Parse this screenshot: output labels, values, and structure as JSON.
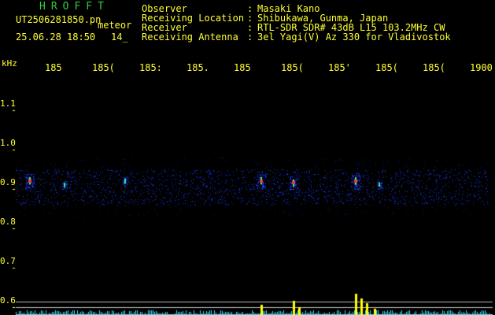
{
  "app": {
    "title": "HROFFT"
  },
  "file": {
    "name": "UT2506281850.pn",
    "tag": "meteor",
    "datetime": "25.06.28 18:50",
    "page": "14_"
  },
  "header": {
    "colon": ":",
    "rows": [
      {
        "label": "Observer",
        "value": "Masaki Kano"
      },
      {
        "label": "Receiving Location",
        "value": "Shibukawa, Gunma, Japan"
      },
      {
        "label": "Receiver",
        "value": "RTL-SDR SDR# 43dB L15 103.2MHz CW"
      },
      {
        "label": "Receiving Antenna",
        "value": "3el Yagi(V) Az 330 for Vladivostok"
      }
    ]
  },
  "axes": {
    "y_unit": "kHz",
    "x_ticks": [
      "185",
      "185(",
      "185:",
      "185.",
      "185",
      "185(",
      "185'",
      "185(",
      "185(",
      "1900"
    ],
    "y_ticks": [
      "1.1",
      "1.0",
      "0.9",
      "0.8",
      "0.7",
      "0.6"
    ]
  },
  "colors": {
    "text": "#ffff33",
    "title": "#33cc44",
    "background": "#000000",
    "noise": "#1a3aff",
    "echo_hot": "#ff3333",
    "echo_warm": "#33ff99",
    "baseline_cyan": "#33e0ff",
    "baseline_peak": "#ffff00",
    "reference_line": "#bbbbbb"
  },
  "chart_data": {
    "type": "heatmap",
    "title": "",
    "xlabel": "",
    "ylabel": "kHz",
    "x_tick_labels": [
      "185",
      "185(",
      "185:",
      "185.",
      "185",
      "185(",
      "185'",
      "185(",
      "185(",
      "1900"
    ],
    "x_range_minutes": [
      1850,
      1900
    ],
    "ylim_khz": [
      0.58,
      1.18
    ],
    "y_ticks": [
      1.1,
      1.0,
      0.9,
      0.8,
      0.7,
      0.6
    ],
    "noise_band_khz": [
      0.86,
      0.95
    ],
    "meteor_echoes": [
      {
        "time": 1851.5,
        "freq_khz": 0.92,
        "strength": 0.9
      },
      {
        "time": 1855.2,
        "freq_khz": 0.91,
        "strength": 0.4
      },
      {
        "time": 1861.6,
        "freq_khz": 0.92,
        "strength": 0.4
      },
      {
        "time": 1876.0,
        "freq_khz": 0.92,
        "strength": 0.9
      },
      {
        "time": 1879.4,
        "freq_khz": 0.915,
        "strength": 0.8
      },
      {
        "time": 1886.0,
        "freq_khz": 0.92,
        "strength": 1.0
      },
      {
        "time": 1888.5,
        "freq_khz": 0.91,
        "strength": 0.3
      }
    ],
    "activity_bars": [
      {
        "time": 1876.0,
        "level": 0.45
      },
      {
        "time": 1879.4,
        "level": 0.65
      },
      {
        "time": 1880.0,
        "level": 0.35
      },
      {
        "time": 1886.0,
        "level": 0.95
      },
      {
        "time": 1886.6,
        "level": 0.75
      },
      {
        "time": 1887.2,
        "level": 0.55
      },
      {
        "time": 1888.0,
        "level": 0.3
      }
    ]
  }
}
